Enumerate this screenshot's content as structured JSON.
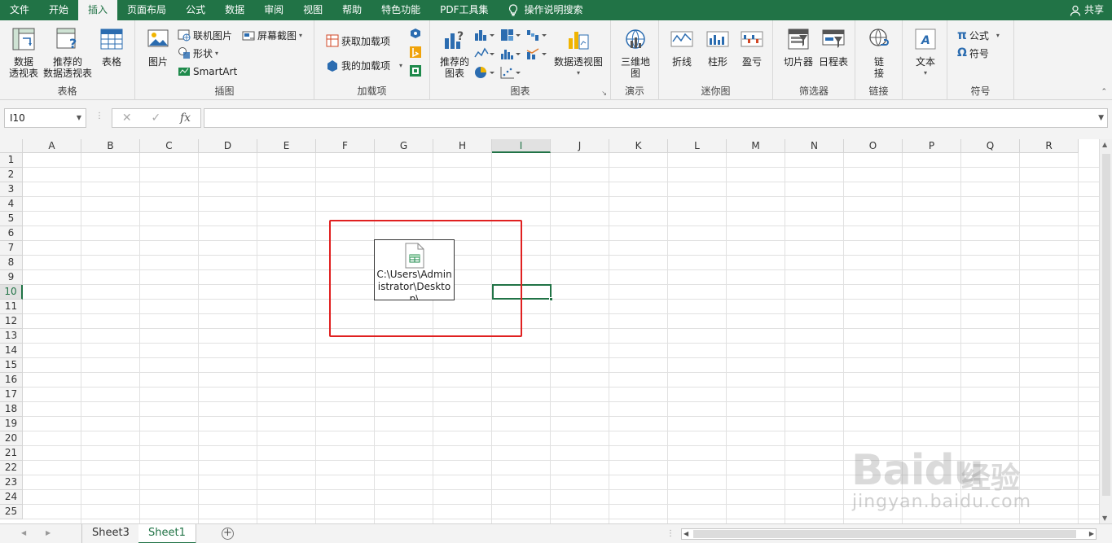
{
  "menu": {
    "tabs": [
      "文件",
      "开始",
      "插入",
      "页面布局",
      "公式",
      "数据",
      "审阅",
      "视图",
      "帮助",
      "特色功能",
      "PDF工具集"
    ],
    "active_tab": "插入",
    "tell_me": "操作说明搜索",
    "share": "共享"
  },
  "ribbon": {
    "tables": {
      "title": "表格",
      "pivot": "数据\n透视表",
      "recommended_pivot": "推荐的\n数据透视表",
      "table": "表格"
    },
    "illustrations": {
      "title": "插图",
      "pictures": "图片",
      "online_pictures": "联机图片",
      "shapes": "形状",
      "smartart": "SmartArt",
      "screenshot": "屏幕截图"
    },
    "addins": {
      "title": "加载项",
      "get_addins": "获取加载项",
      "my_addins": "我的加载项"
    },
    "charts": {
      "title": "图表",
      "recommended": "推荐的\n图表",
      "pivot_chart": "数据透视图"
    },
    "tours": {
      "title": "演示",
      "map3d": "三维地\n图"
    },
    "sparklines": {
      "title": "迷你图",
      "line": "折线",
      "column": "柱形",
      "winloss": "盈亏"
    },
    "filters": {
      "title": "筛选器",
      "slicer": "切片器",
      "timeline": "日程表"
    },
    "links": {
      "title": "链接",
      "link": "链\n接"
    },
    "text": {
      "title": "",
      "text": "文本"
    },
    "symbols": {
      "title": "符号",
      "equation": "公式",
      "symbol": "符号"
    }
  },
  "formula_bar": {
    "name_box": "I10",
    "formula": ""
  },
  "grid": {
    "columns": [
      "A",
      "B",
      "C",
      "D",
      "E",
      "F",
      "G",
      "H",
      "I",
      "J",
      "K",
      "L",
      "M",
      "N",
      "O",
      "P",
      "Q",
      "R"
    ],
    "rows": [
      "1",
      "2",
      "3",
      "4",
      "5",
      "6",
      "7",
      "8",
      "9",
      "10",
      "11",
      "12",
      "13",
      "14",
      "15",
      "16",
      "17",
      "18",
      "19",
      "20",
      "21",
      "22",
      "23",
      "24",
      "25"
    ],
    "selected_column": "I",
    "selected_row": "10"
  },
  "embedded_object": {
    "path_text": "C:\\Users\\Administrator\\Desktop\\"
  },
  "sheets": {
    "tabs": [
      "Sheet3",
      "Sheet1"
    ],
    "active": "Sheet1"
  },
  "watermark": {
    "brand": "Baidu",
    "cn": "经验",
    "url": "jingyan.baidu.com"
  },
  "colors": {
    "accent": "#217346",
    "highlight": "#e02020"
  }
}
